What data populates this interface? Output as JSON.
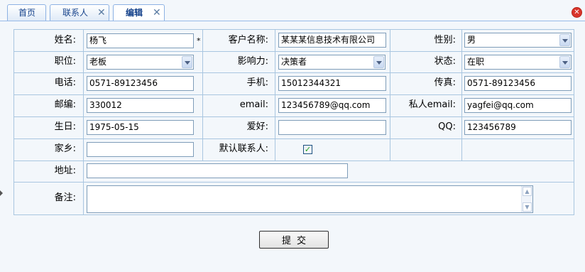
{
  "tabs": [
    {
      "label": "首页",
      "closable": false,
      "active": false
    },
    {
      "label": "联系人",
      "closable": true,
      "active": false
    },
    {
      "label": "编辑",
      "closable": true,
      "active": true
    }
  ],
  "close_all_icon": "close-icon",
  "form": {
    "name": {
      "label": "姓名:",
      "value": "杨飞",
      "required_mark": "*"
    },
    "customer_name": {
      "label": "客户名称:",
      "value": "某某某信息技术有限公司"
    },
    "gender": {
      "label": "性别:",
      "value": "男"
    },
    "position": {
      "label": "职位:",
      "value": "老板"
    },
    "influence": {
      "label": "影响力:",
      "value": "决策者"
    },
    "status": {
      "label": "状态:",
      "value": "在职"
    },
    "phone": {
      "label": "电话:",
      "value": "0571-89123456"
    },
    "mobile": {
      "label": "手机:",
      "value": "15012344321"
    },
    "fax": {
      "label": "传真:",
      "value": "0571-89123456"
    },
    "postcode": {
      "label": "邮编:",
      "value": "330012"
    },
    "email": {
      "label": "email:",
      "value": "123456789@qq.com"
    },
    "private_email": {
      "label": "私人email:",
      "value": "yagfei@qq.com"
    },
    "birthday": {
      "label": "生日:",
      "value": "1975-05-15"
    },
    "hobby": {
      "label": "爱好:",
      "value": ""
    },
    "qq": {
      "label": "QQ:",
      "value": "123456789"
    },
    "hometown": {
      "label": "家乡:",
      "value": ""
    },
    "default_contact": {
      "label": "默认联系人:",
      "checked": true,
      "check_glyph": "✓"
    },
    "address": {
      "label": "地址:",
      "value": ""
    },
    "remark": {
      "label": "备注:",
      "value": ""
    }
  },
  "submit_label": "提交",
  "colors": {
    "border": "#a9c6e0",
    "tab_text": "#15428b",
    "background": "#f3f7fb"
  }
}
